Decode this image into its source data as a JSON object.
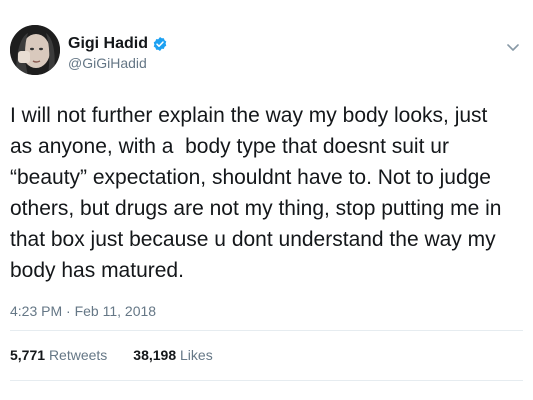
{
  "user": {
    "display_name": "Gigi Hadid",
    "handle": "@GiGiHadid",
    "verified": true,
    "verified_color": "#1da1f2"
  },
  "tweet": {
    "text": "I will not further explain the way my body looks, just\nas anyone, with a  body type that doesnt suit ur\n“beauty” expectation, shouldnt have to. Not to judge\nothers, but drugs are not my thing, stop putting me in\nthat box just because u dont understand the way my\nbody has matured.",
    "timestamp": "4:23 PM · Feb 11, 2018"
  },
  "stats": {
    "retweets_count": "5,771",
    "retweets_label": "Retweets",
    "likes_count": "38,198",
    "likes_label": "Likes"
  },
  "icons": {
    "verified": "verified-badge-icon",
    "menu": "chevron-down-icon"
  }
}
